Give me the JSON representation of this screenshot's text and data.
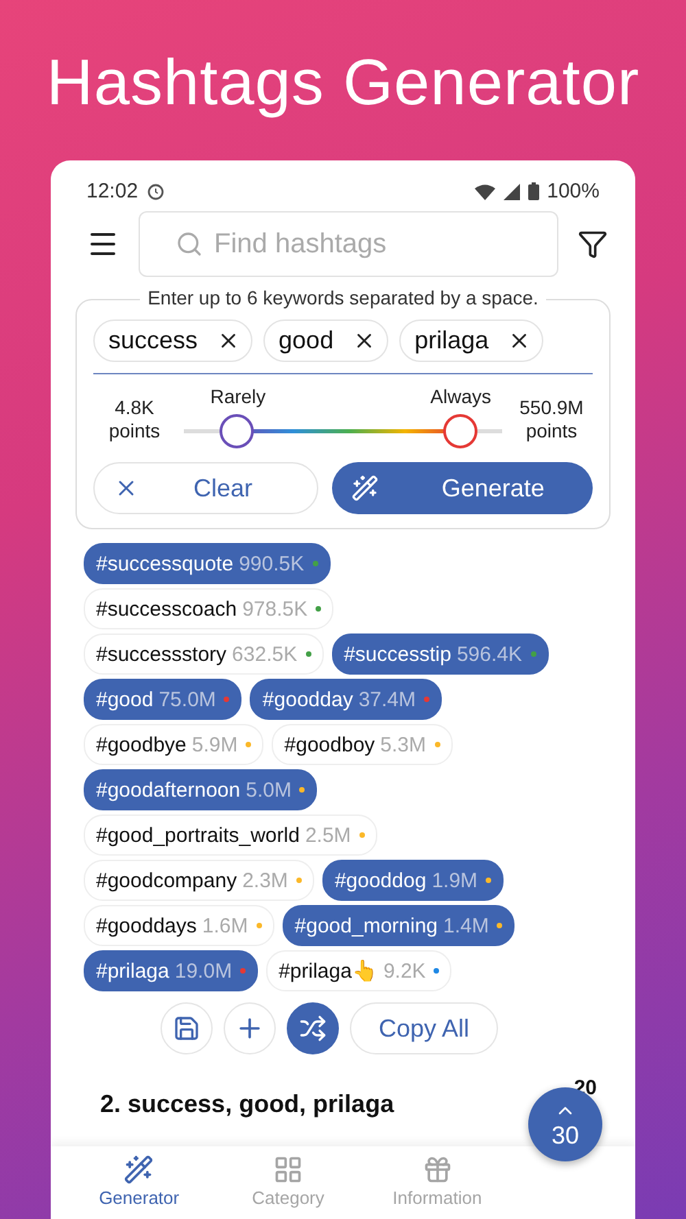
{
  "headline": "Hashtags Generator",
  "status_bar": {
    "time": "12:02",
    "battery": "100%"
  },
  "search": {
    "placeholder": "Find hashtags"
  },
  "keywords": {
    "legend": "Enter up to 6 keywords separated by a space.",
    "chips": [
      "success",
      "good",
      "prilaga"
    ]
  },
  "popularity": {
    "min_label": "4.8K points",
    "max_label": "550.9M points",
    "low_label": "Rarely",
    "high_label": "Always",
    "low": {
      "level": 0.17
    },
    "high": {
      "level": 0.87
    }
  },
  "buttons": {
    "clear": "Clear",
    "generate": "Generate"
  },
  "hashtag_rows": [
    [
      {
        "tag": "#successquote",
        "count": "990.5K",
        "selected": true,
        "color": "#43a047"
      }
    ],
    [
      {
        "tag": "#successcoach",
        "count": "978.5K",
        "selected": false,
        "color": "#43a047"
      }
    ],
    [
      {
        "tag": "#successstory",
        "count": "632.5K",
        "selected": false,
        "color": "#43a047"
      },
      {
        "tag": "#successtip",
        "count": "596.4K",
        "selected": true,
        "color": "#43a047"
      }
    ],
    [
      {
        "tag": "#good",
        "count": "75.0M",
        "selected": true,
        "color": "#e53935"
      },
      {
        "tag": "#goodday",
        "count": "37.4M",
        "selected": true,
        "color": "#e53935"
      }
    ],
    [
      {
        "tag": "#goodbye",
        "count": "5.9M",
        "selected": false,
        "color": "#fbb829"
      },
      {
        "tag": "#goodboy",
        "count": "5.3M",
        "selected": false,
        "color": "#fbb829"
      }
    ],
    [
      {
        "tag": "#goodafternoon",
        "count": "5.0M",
        "selected": true,
        "color": "#fbb829"
      }
    ],
    [
      {
        "tag": "#good_portraits_world",
        "count": "2.5M",
        "selected": false,
        "color": "#fbb829"
      }
    ],
    [
      {
        "tag": "#goodcompany",
        "count": "2.3M",
        "selected": false,
        "color": "#fbb829"
      },
      {
        "tag": "#gooddog",
        "count": "1.9M",
        "selected": true,
        "color": "#fbb829"
      }
    ],
    [
      {
        "tag": "#gooddays",
        "count": "1.6M",
        "selected": false,
        "color": "#fbb829"
      },
      {
        "tag": "#good_morning",
        "count": "1.4M",
        "selected": true,
        "color": "#fbb829"
      }
    ],
    [
      {
        "tag": "#prilaga",
        "count": "19.0M",
        "selected": true,
        "color": "#e53935"
      },
      {
        "tag": "#prilaga👆",
        "count": "9.2K",
        "selected": false,
        "color": "#1e88e5"
      }
    ]
  ],
  "actions": {
    "shuffle_on": true,
    "copy_all": "Copy All"
  },
  "section": {
    "title": "2. success, good, prilaga",
    "count": "20"
  },
  "fab": "30",
  "nav": [
    {
      "label": "Generator",
      "selected": true,
      "kind": "wand"
    },
    {
      "label": "Category",
      "selected": false,
      "kind": "grid"
    },
    {
      "label": "Information",
      "selected": false,
      "kind": "gift"
    }
  ]
}
